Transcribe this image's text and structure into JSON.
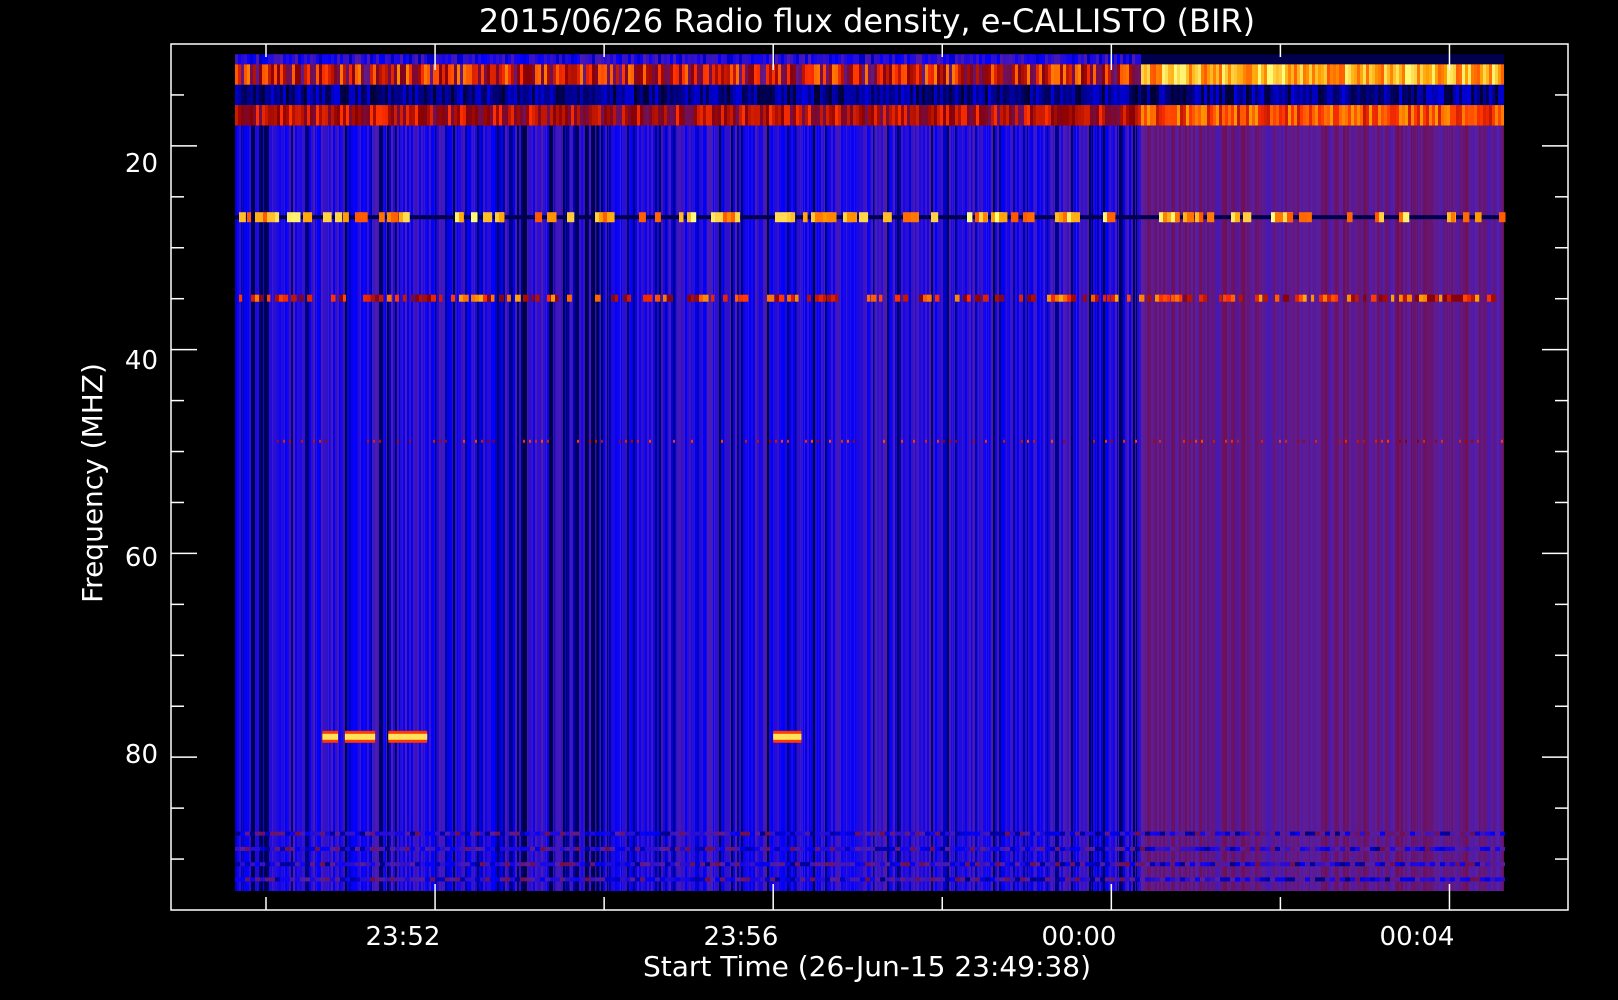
{
  "chart_data": {
    "type": "heatmap",
    "title": "2015/06/26  Radio flux density, e-CALLISTO (BIR)",
    "xlabel": "Start Time (26-Jun-15 23:49:38)",
    "ylabel": "Frequency (MHZ)",
    "x_ticks": [
      "23:52",
      "23:56",
      "00:00",
      "00:04"
    ],
    "y_ticks": [
      20,
      40,
      60,
      80
    ],
    "ylim": [
      10,
      95
    ],
    "y_inverted": true,
    "data_xlim": [
      "23:49:38",
      "00:04:38"
    ],
    "colormap": [
      "#000000",
      "#0000ff",
      "#5a1ea0",
      "#8b0000",
      "#ff3000",
      "#ffa000",
      "#ffff80"
    ],
    "colors": {
      "background": "#000000",
      "axes": "#ffffff",
      "base": "#3a1fd0",
      "quiet_base": "#4a22b0"
    },
    "features": [
      {
        "desc": "narrowband interference",
        "freq": 13,
        "t_start": "23:49:38",
        "t_end": "00:04:38",
        "level": "high"
      },
      {
        "desc": "narrowband interference",
        "freq": 17.5,
        "t_start": "23:49:38",
        "t_end": "00:04:38",
        "level": "medium"
      },
      {
        "desc": "narrowband interference",
        "freq": 27,
        "t_start": "23:49:38",
        "t_end": "00:04:38",
        "level": "high-intermittent"
      },
      {
        "desc": "narrowband interference",
        "freq": 35,
        "t_start": "23:49:38",
        "t_end": "00:04:38",
        "level": "medium"
      },
      {
        "desc": "narrowband interference",
        "freq": 49,
        "t_start": "23:49:38",
        "t_end": "00:04:38",
        "level": "low"
      },
      {
        "desc": "bursts",
        "freq": 78,
        "t_start": "23:50:40",
        "t_end": "23:52:00",
        "level": "high"
      },
      {
        "desc": "burst",
        "freq": 78,
        "t_start": "23:56:00",
        "t_end": "23:56:20",
        "level": "high"
      },
      {
        "desc": "regime change",
        "t": "00:00:20"
      }
    ]
  }
}
